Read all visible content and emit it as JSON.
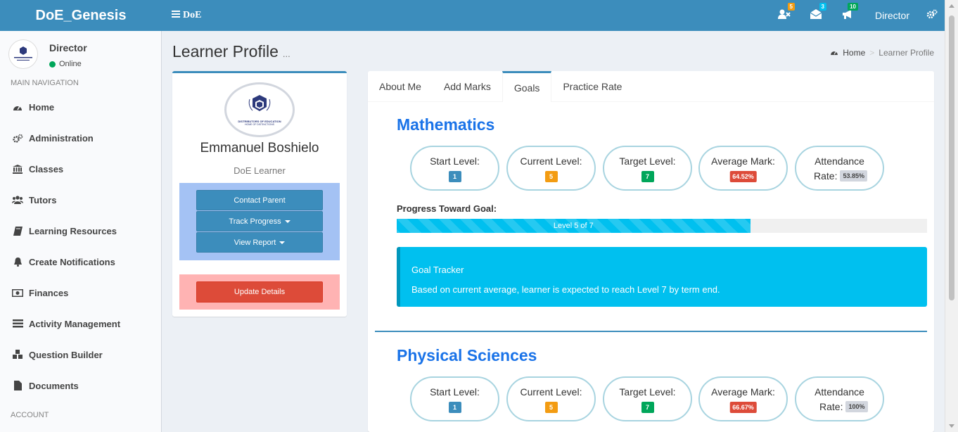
{
  "header": {
    "brand": "DoE_Genesis",
    "toggle_label": "DoE",
    "badges": [
      {
        "icon": "user-times-icon",
        "count": "5",
        "color": "#f39c12"
      },
      {
        "icon": "envelope-icon",
        "count": "3",
        "color": "#00c0ef"
      },
      {
        "icon": "bullhorn-icon",
        "count": "10",
        "color": "#00a65a"
      }
    ],
    "user": "Director"
  },
  "sidebar": {
    "user_name": "Director",
    "status": "Online",
    "section_main": "MAIN NAVIGATION",
    "items": [
      {
        "label": "Home",
        "icon": "dashboard-icon"
      },
      {
        "label": "Administration",
        "icon": "cogs-icon"
      },
      {
        "label": "Classes",
        "icon": "institution-icon"
      },
      {
        "label": "Tutors",
        "icon": "users-icon"
      },
      {
        "label": "Learning Resources",
        "icon": "book-icon"
      },
      {
        "label": "Create Notifications",
        "icon": "bell-icon"
      },
      {
        "label": "Finances",
        "icon": "money-icon"
      },
      {
        "label": "Activity Management",
        "icon": "tasks-icon"
      },
      {
        "label": "Question Builder",
        "icon": "cubes-icon"
      },
      {
        "label": "Documents",
        "icon": "file-icon"
      }
    ],
    "section_account": "ACCOUNT"
  },
  "page": {
    "title": "Learner Profile",
    "subtitle": "...",
    "breadcrumb_home": "Home",
    "breadcrumb_current": "Learner Profile"
  },
  "profile": {
    "logo_text_1": "DISTRIBUTORS OF EDUCATION",
    "logo_text_2": "HOME OF DISTINCTIONS",
    "name": "Emmanuel Boshielo",
    "role": "DoE Learner",
    "contact_parent": "Contact Parent",
    "track_progress": "Track Progress",
    "view_report": "View Report",
    "update_details": "Update Details"
  },
  "tabs": [
    "About Me",
    "Add Marks",
    "Goals",
    "Practice Rate"
  ],
  "labels": {
    "start": "Start Level:",
    "current": "Current Level:",
    "target": "Target Level:",
    "average": "Average Mark:",
    "attendance": "Attendance",
    "rate": "Rate:",
    "progress": "Progress Toward Goal:"
  },
  "colors": {
    "start": "#3c8dbc",
    "current": "#f39c12",
    "target": "#00a65a",
    "average": "#dd4b39"
  },
  "subjects": [
    {
      "name": "Mathematics",
      "start": "1",
      "current": "5",
      "target": "7",
      "average": "64.52%",
      "attendance": "53.85%",
      "progress_text": "Level 5 of 7",
      "progress_fraction": 0.6667,
      "tracker_title": "Goal Tracker",
      "tracker_text": "Based on current average, learner is expected to reach Level 7 by term end."
    },
    {
      "name": "Physical Sciences",
      "start": "1",
      "current": "5",
      "target": "7",
      "average": "66.67%",
      "attendance": "100%"
    }
  ]
}
